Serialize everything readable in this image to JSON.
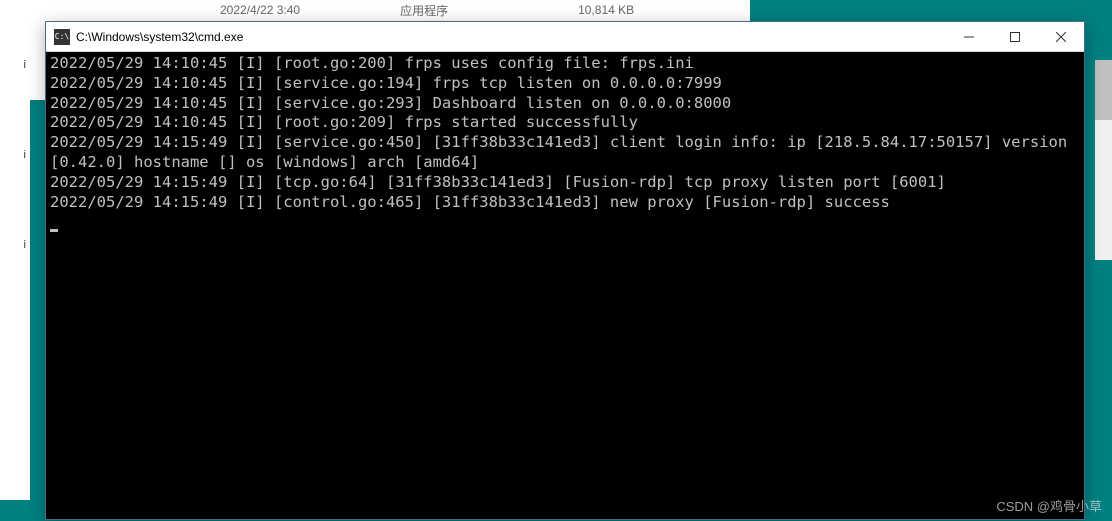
{
  "explorer": {
    "row": {
      "date": "2022/4/22 3:40",
      "type": "应用程序",
      "size": "10,814 KB"
    },
    "side_ext": "i"
  },
  "window": {
    "title": "C:\\Windows\\system32\\cmd.exe",
    "icon_label": "C:\\",
    "minimize": "—",
    "maximize": "□",
    "close": "✕"
  },
  "console": {
    "lines": [
      "2022/05/29 14:10:45 [I] [root.go:200] frps uses config file: frps.ini",
      "2022/05/29 14:10:45 [I] [service.go:194] frps tcp listen on 0.0.0.0:7999",
      "2022/05/29 14:10:45 [I] [service.go:293] Dashboard listen on 0.0.0.0:8000",
      "2022/05/29 14:10:45 [I] [root.go:209] frps started successfully",
      "2022/05/29 14:15:49 [I] [service.go:450] [31ff38b33c141ed3] client login info: ip [218.5.84.17:50157] version [0.42.0] hostname [] os [windows] arch [amd64]",
      "2022/05/29 14:15:49 [I] [tcp.go:64] [31ff38b33c141ed3] [Fusion-rdp] tcp proxy listen port [6001]",
      "2022/05/29 14:15:49 [I] [control.go:465] [31ff38b33c141ed3] new proxy [Fusion-rdp] success"
    ]
  },
  "watermark": "CSDN @鸡骨小草"
}
